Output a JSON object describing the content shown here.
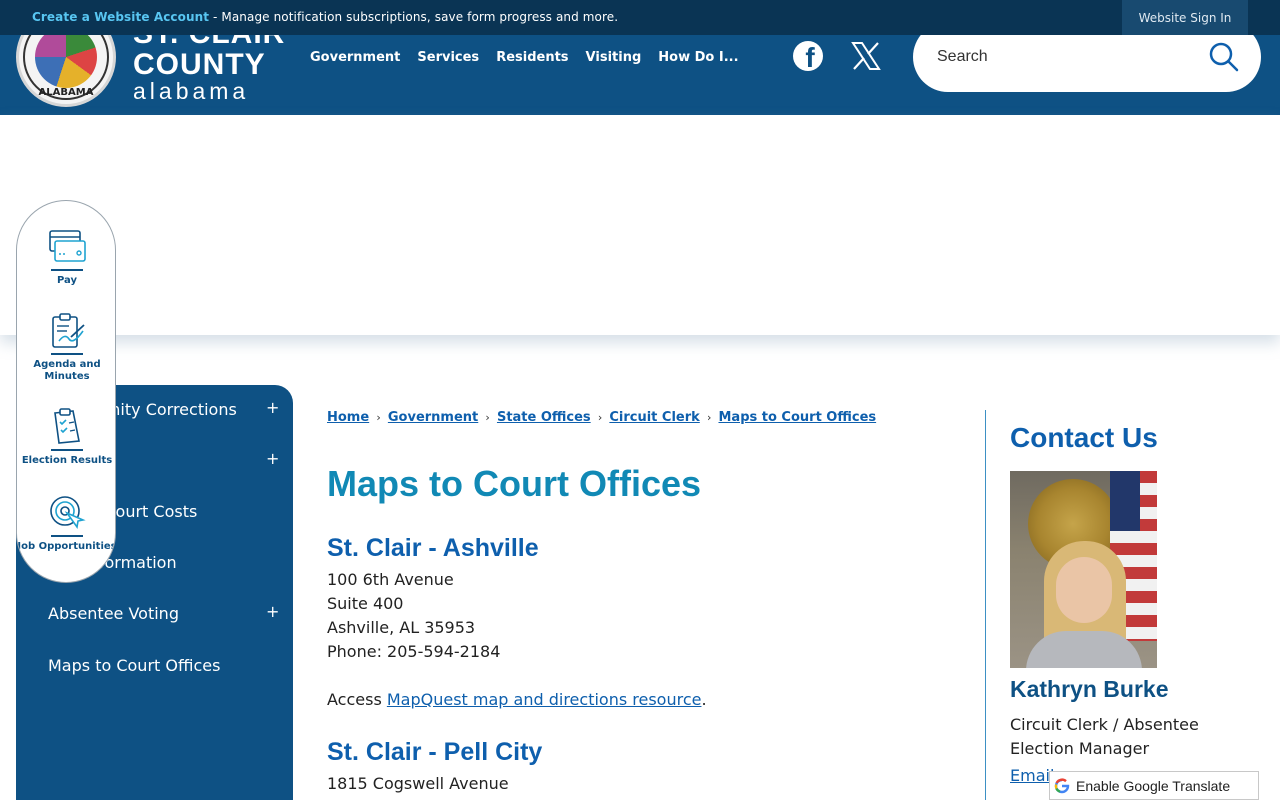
{
  "topbar": {
    "create_link": "Create a Website Account",
    "create_msg": " - Manage notification subscriptions, save form progress and more.",
    "signin": "Website Sign In"
  },
  "header": {
    "brand_line1": "ST. CLAIR",
    "brand_line2": "COUNTY",
    "brand_line3": "alabama",
    "seal_text": "ALABAMA",
    "nav": [
      "Government",
      "Services",
      "Residents",
      "Visiting",
      "How Do I..."
    ],
    "search_placeholder": "Search"
  },
  "quick_links": [
    {
      "label": "Pay",
      "icon": "credit-card-icon"
    },
    {
      "label": "Agenda and Minutes",
      "icon": "clipboard-sign-icon"
    },
    {
      "label": "Election Results",
      "icon": "ballot-checklist-icon"
    },
    {
      "label": "Job Opportunities",
      "icon": "target-cursor-icon"
    }
  ],
  "sidenav": {
    "items": [
      {
        "label": "Community Corrections",
        "expandable": true
      },
      {
        "label": "",
        "expandable": true
      },
      {
        "label": "Fines / Court Costs",
        "expandable": false
      },
      {
        "label": "Jury Information",
        "expandable": false
      },
      {
        "label": "Absentee Voting",
        "expandable": true
      },
      {
        "label": "Maps to Court Offices",
        "expandable": false
      }
    ],
    "plus_symbol": "+"
  },
  "breadcrumb": [
    "Home",
    "Government",
    "State Offices",
    "Circuit Clerk",
    "Maps to Court Offices"
  ],
  "breadcrumb_sep": "›",
  "page": {
    "title": "Maps to Court Offices",
    "offices": [
      {
        "name": "St. Clair - Ashville",
        "address1": "100 6th Avenue",
        "address2": "Suite 400",
        "city": "Ashville, AL 35953",
        "phone": "Phone: 205-594-2184",
        "access_prefix": "Access ",
        "access_link": "MapQuest map and directions resource",
        "access_suffix": "."
      },
      {
        "name": "St. Clair - Pell City",
        "address1": "1815 Cogswell Avenue"
      }
    ]
  },
  "contact": {
    "heading": "Contact Us",
    "name": "Kathryn Burke",
    "title": "Circuit Clerk / Absentee Election Manager",
    "email": "Email"
  },
  "translate": "Enable Google Translate",
  "colors": {
    "header_blue": "#0e5184",
    "topbar_navy": "#0a3454",
    "title_teal": "#1189b5",
    "link_blue": "#0e5fad"
  }
}
